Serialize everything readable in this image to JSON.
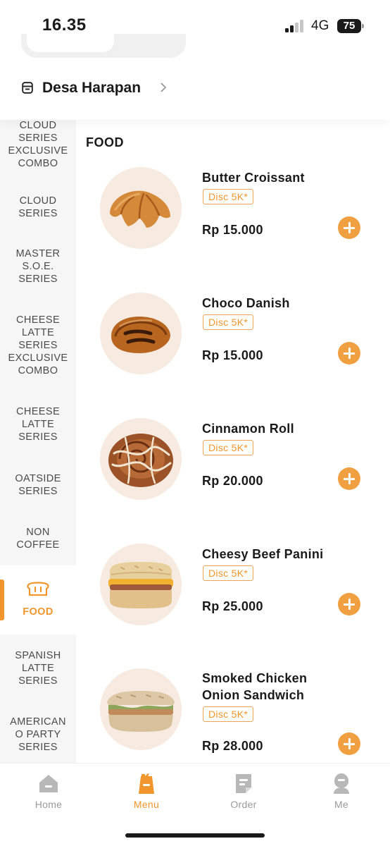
{
  "status_bar": {
    "time": "16.35",
    "network": "4G",
    "battery": "75"
  },
  "store": {
    "name": "Desa Harapan",
    "icon": "store-icon"
  },
  "sidebar": {
    "items": [
      {
        "label": "CLOUD\nSERIES\nEXCLUSIVE\nCOMBO",
        "active": false
      },
      {
        "label": "CLOUD\nSERIES",
        "active": false
      },
      {
        "label": "MASTER\nS.O.E.\nSERIES",
        "active": false
      },
      {
        "label": "CHEESE\nLATTE\nSERIES\nEXCLUSIVE\nCOMBO",
        "active": false
      },
      {
        "label": "CHEESE\nLATTE\nSERIES",
        "active": false
      },
      {
        "label": "OATSIDE\nSERIES",
        "active": false
      },
      {
        "label": "NON\nCOFFEE",
        "active": false
      },
      {
        "label": "FOOD",
        "active": true,
        "icon": "bread-icon"
      },
      {
        "label": "SPANISH\nLATTE\nSERIES",
        "active": false
      },
      {
        "label": "AMERICAN\nO PARTY\nSERIES",
        "active": false
      }
    ]
  },
  "main": {
    "section_title": "FOOD",
    "products": [
      {
        "name": "Butter Croissant",
        "discount": "Disc 5K*",
        "price": "Rp 15.000",
        "image": "croissant"
      },
      {
        "name": "Choco Danish",
        "discount": "Disc 5K*",
        "price": "Rp 15.000",
        "image": "danish"
      },
      {
        "name": "Cinnamon Roll",
        "discount": "Disc 5K*",
        "price": "Rp 20.000",
        "image": "cinnamon-roll"
      },
      {
        "name": "Cheesy Beef Panini",
        "discount": "Disc 5K*",
        "price": "Rp 25.000",
        "image": "panini"
      },
      {
        "name": "Smoked Chicken Onion Sandwich",
        "discount": "Disc 5K*",
        "price": "Rp 28.000",
        "image": "sandwich"
      }
    ]
  },
  "bottom_nav": {
    "items": [
      {
        "label": "Home",
        "icon": "home-icon",
        "active": false
      },
      {
        "label": "Menu",
        "icon": "cup-icon",
        "active": true
      },
      {
        "label": "Order",
        "icon": "order-icon",
        "active": false
      },
      {
        "label": "Me",
        "icon": "profile-icon",
        "active": false
      }
    ]
  },
  "colors": {
    "accent": "#f0962d",
    "add_button": "#f0a040",
    "sidebar_bg": "#f6f6f6",
    "image_bg": "#f7ebe1"
  }
}
